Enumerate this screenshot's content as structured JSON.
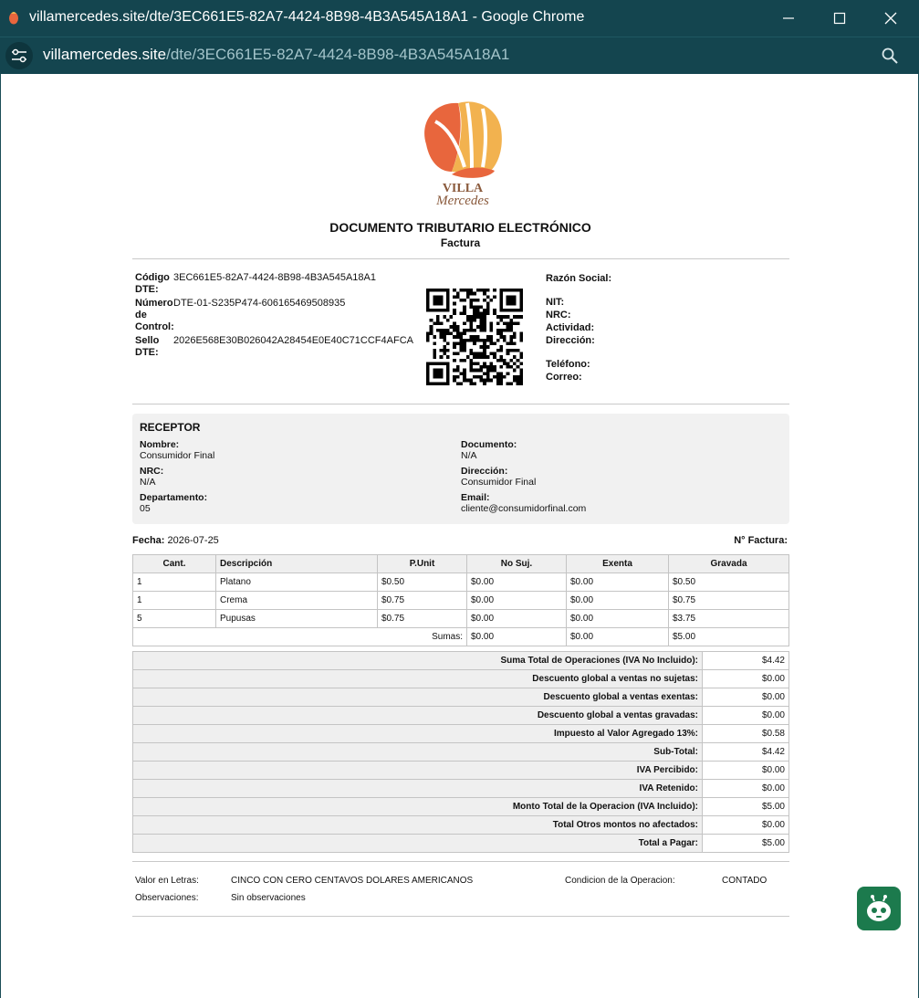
{
  "window": {
    "title": "villamercedes.site/dte/3EC661E5-82A7-4424-8B98-4B3A545A18A1 - Google Chrome"
  },
  "address_bar": {
    "host": "villamercedes.site",
    "path": "/dte/3EC661E5-82A7-4424-8B98-4B3A545A18A1"
  },
  "document": {
    "logo_text_line1": "VILLA",
    "logo_text_line2": "Mercedes",
    "title": "DOCUMENTO TRIBUTARIO ELECTRÓNICO",
    "subtitle": "Factura",
    "codigo_label_1": "Código",
    "codigo_label_2": "DTE:",
    "codigo_value": "3EC661E5-82A7-4424-8B98-4B3A545A18A1",
    "numero_label_1": "Número",
    "numero_label_2": "de",
    "numero_label_3": "Control:",
    "numero_value": "DTE-01-S235P474-606165469508935",
    "sello_label_1": "Sello",
    "sello_label_2": "DTE:",
    "sello_value": "2026E568E30B026042A28454E0E40C71CCF4AFCA",
    "emisor": {
      "razon_social": "Razón Social:",
      "nit": "NIT:",
      "nrc": "NRC:",
      "actividad": "Actividad:",
      "direccion": "Dirección:",
      "telefono": "Teléfono:",
      "correo": "Correo:"
    }
  },
  "receptor": {
    "heading": "RECEPTOR",
    "nombre_label": "Nombre:",
    "nombre_value": "Consumidor Final",
    "documento_label": "Documento:",
    "documento_value": "N/A",
    "nrc_label": "NRC:",
    "nrc_value": "N/A",
    "direccion_label": "Dirección:",
    "direccion_value": "Consumidor Final",
    "departamento_label": "Departamento:",
    "departamento_value": "05",
    "email_label": "Email:",
    "email_value": "cliente@consumidorfinal.com"
  },
  "fecha_label": "Fecha:",
  "fecha_value": "2026-07-25",
  "nfactura_label": "N° Factura:",
  "items": {
    "headers": [
      "Cant.",
      "Descripción",
      "P.Unit",
      "No Suj.",
      "Exenta",
      "Gravada"
    ],
    "rows": [
      [
        "1",
        "Platano",
        "$0.50",
        "$0.00",
        "$0.00",
        "$0.50"
      ],
      [
        "1",
        "Crema",
        "$0.75",
        "$0.00",
        "$0.00",
        "$0.75"
      ],
      [
        "5",
        "Pupusas",
        "$0.75",
        "$0.00",
        "$0.00",
        "$3.75"
      ]
    ],
    "sumas_label": "Sumas:",
    "sumas": [
      "$0.00",
      "$0.00",
      "$5.00"
    ]
  },
  "totals": [
    {
      "label": "Suma Total de Operaciones (IVA No Incluido):",
      "value": "$4.42"
    },
    {
      "label": "Descuento global a ventas no sujetas:",
      "value": "$0.00"
    },
    {
      "label": "Descuento global a ventas exentas:",
      "value": "$0.00"
    },
    {
      "label": "Descuento global a ventas gravadas:",
      "value": "$0.00"
    },
    {
      "label": "Impuesto al Valor Agregado 13%:",
      "value": "$0.58"
    },
    {
      "label": "Sub-Total:",
      "value": "$4.42"
    },
    {
      "label": "IVA Percibido:",
      "value": "$0.00"
    },
    {
      "label": "IVA Retenido:",
      "value": "$0.00"
    },
    {
      "label": "Monto Total de la Operacion (IVA Incluido):",
      "value": "$5.00"
    },
    {
      "label": "Total Otros montos no afectados:",
      "value": "$0.00"
    },
    {
      "label": "Total a Pagar:",
      "value": "$5.00"
    }
  ],
  "footer": {
    "valor_letras_label": "Valor en Letras:",
    "valor_letras_value": "CINCO CON CERO CENTAVOS DOLARES AMERICANOS",
    "condicion_label": "Condicion de la Operacion:",
    "condicion_value": "CONTADO",
    "observaciones_label": "Observaciones:",
    "observaciones_value": "Sin observaciones"
  },
  "colors": {
    "chrome_bar": "#14454f",
    "logo_orange": "#e8663d",
    "logo_yellow": "#f2b24f",
    "logo_brown": "#8a5a3c",
    "badge_green": "#1c7a4d"
  }
}
